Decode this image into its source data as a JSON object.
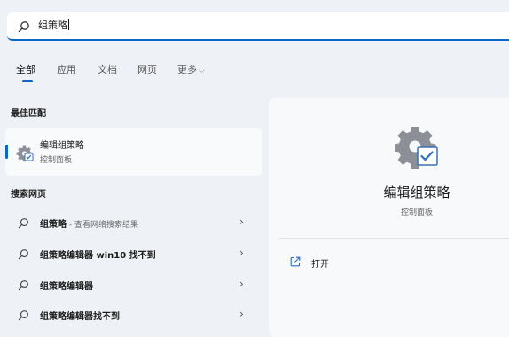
{
  "search": {
    "query": "组策略",
    "icon": "search-icon"
  },
  "tabs": [
    {
      "label": "全部",
      "active": true
    },
    {
      "label": "应用",
      "active": false
    },
    {
      "label": "文档",
      "active": false
    },
    {
      "label": "网页",
      "active": false
    },
    {
      "label": "更多",
      "active": false
    }
  ],
  "best_match": {
    "section_title": "最佳匹配",
    "title": "编辑组策略",
    "subtitle": "控制面板",
    "icon": "group-policy-icon"
  },
  "web_search": {
    "section_title": "搜索网页",
    "results": [
      {
        "bold": "组策略",
        "suffix": " - 查看网络搜索结果"
      },
      {
        "bold": "组策略编辑器 win10 找不到",
        "suffix": ""
      },
      {
        "bold": "组策略编辑器",
        "suffix": ""
      },
      {
        "bold": "组策略编辑器找不到",
        "suffix": ""
      }
    ]
  },
  "detail": {
    "title": "编辑组策略",
    "subtitle": "控制面板",
    "actions": [
      {
        "label": "打开",
        "icon": "open-external-icon"
      }
    ]
  },
  "colors": {
    "accent": "#0a66c9",
    "background": "#eef1f6"
  }
}
